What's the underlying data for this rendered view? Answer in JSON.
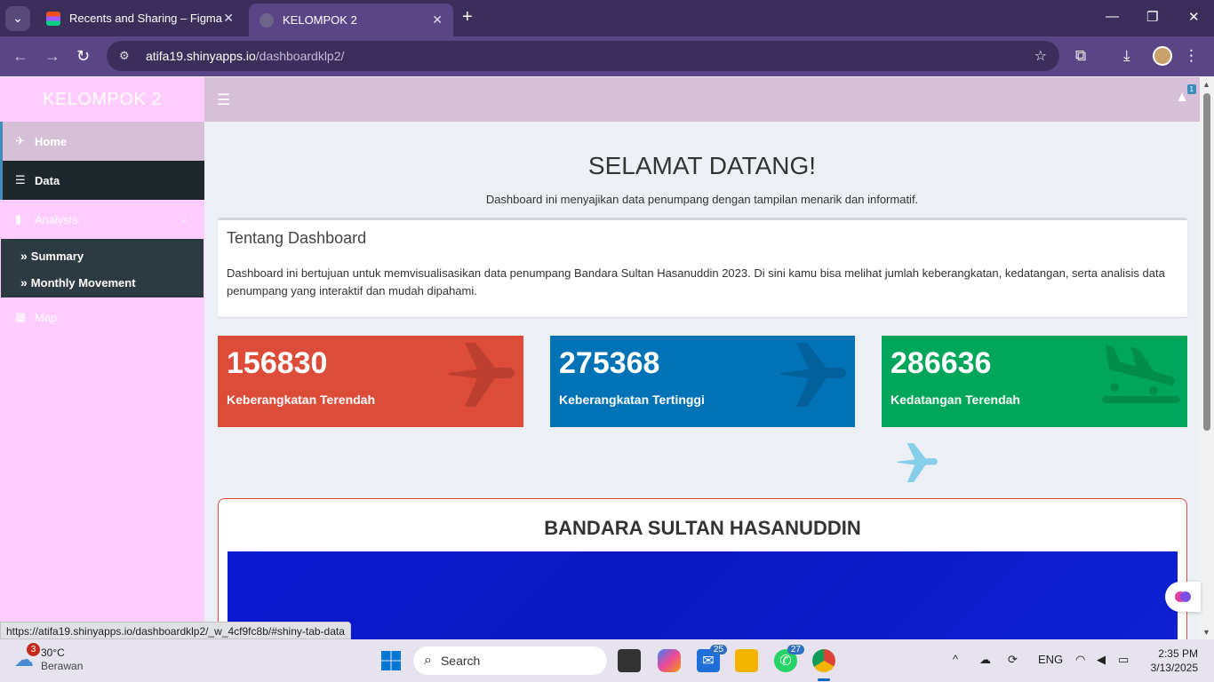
{
  "browser": {
    "tabs": [
      {
        "title": "Recents and Sharing – Figma",
        "active": false
      },
      {
        "title": "KELOMPOK 2",
        "active": true
      }
    ],
    "url_host": "atifa19.shinyapps.io",
    "url_path": "/dashboardklp2/",
    "status_url": "https://atifa19.shinyapps.io/dashboardklp2/_w_4cf9fc8b/#shiny-tab-data"
  },
  "sidebar": {
    "brand": "KELOMPOK 2",
    "items": [
      {
        "label": "Home",
        "icon": "plane-departure-icon",
        "state": "hover"
      },
      {
        "label": "Data",
        "icon": "database-icon",
        "state": "active"
      },
      {
        "label": "Analysis",
        "icon": "bar-chart-icon",
        "state": "expanded"
      }
    ],
    "analysis_sub": [
      {
        "label": "Summary"
      },
      {
        "label": "Monthly Movement"
      }
    ],
    "map_label": "Map"
  },
  "header": {
    "notification_count": "1"
  },
  "main": {
    "welcome_title": "SELAMAT DATANG!",
    "welcome_sub": "Dashboard ini menyajikan data penumpang dengan tampilan menarik dan informatif.",
    "about_title": "Tentang Dashboard",
    "about_body": "Dashboard ini bertujuan untuk memvisualisasikan data penumpang Bandara Sultan Hasanuddin 2023. Di sini kamu bisa melihat jumlah keberangkatan, kedatangan, serta analisis data penumpang yang interaktif dan mudah dipahami.",
    "value_boxes": [
      {
        "value": "156830",
        "label": "Keberangkatan Terendah",
        "color": "#dd4b39",
        "icon": "plane-icon"
      },
      {
        "value": "275368",
        "label": "Keberangkatan Tertinggi",
        "color": "#0073b7",
        "icon": "plane-icon"
      },
      {
        "value": "286636",
        "label": "Kedatangan Terendah",
        "color": "#00a65a",
        "icon": "plane-arrival-icon"
      }
    ],
    "airport_title": "BANDARA SULTAN HASANUDDIN"
  },
  "taskbar": {
    "weather_temp": "30°C",
    "weather_desc": "Berawan",
    "weather_badge": "3",
    "search_placeholder": "Search",
    "mail_badge": "25",
    "whatsapp_badge": "27",
    "lang": "ENG",
    "time": "2:35 PM",
    "date": "3/13/2025"
  },
  "colors": {
    "sidebar_bg": "#ffccff",
    "header_bg": "#d8bfd8",
    "active_item_bg": "#1e282c",
    "accent": "#3c8dbc"
  }
}
